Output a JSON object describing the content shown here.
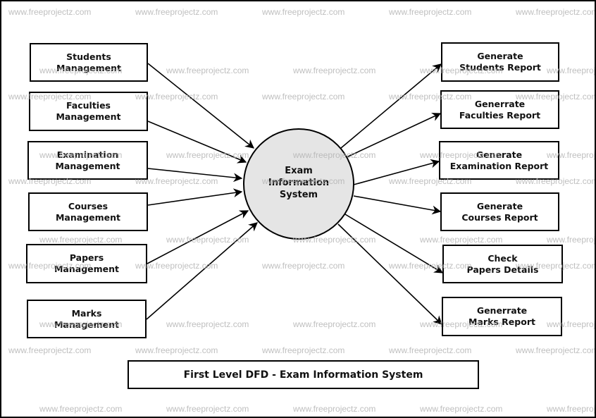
{
  "diagram": {
    "process": {
      "label": "Exam\nInformation\nSystem",
      "fill": "#e5e5e5"
    },
    "inputs": [
      {
        "label": "Students\nManagement"
      },
      {
        "label": "Faculties\nManagement"
      },
      {
        "label": "Examination\nManagement"
      },
      {
        "label": "Courses\nManagement"
      },
      {
        "label": "Papers\nManagement"
      },
      {
        "label": "Marks\nManagement"
      }
    ],
    "outputs": [
      {
        "label": "Generate\nStudents Report"
      },
      {
        "label": "Generrate\nFaculties Report"
      },
      {
        "label": "Generate\nExamination Report"
      },
      {
        "label": "Generate\nCourses Report"
      },
      {
        "label": "Check\nPapers Details"
      },
      {
        "label": "Generrate\nMarks Report"
      }
    ],
    "title": "First Level DFD - Exam Information System",
    "watermark": "www.freeprojectz.com"
  }
}
